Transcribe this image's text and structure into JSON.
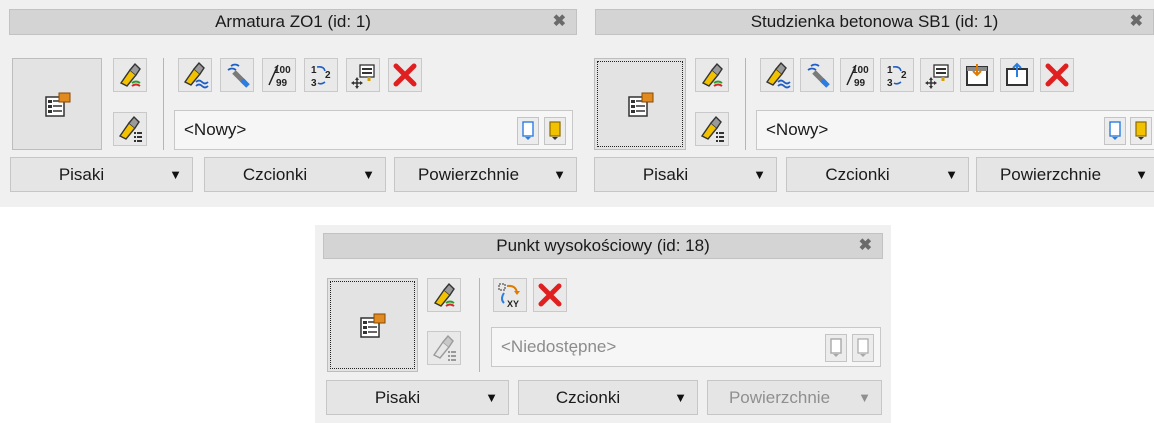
{
  "panels": [
    {
      "title": "Armatura ZO1 (id: 1)",
      "close_glyph": "✖",
      "name_value": "<Nowy>",
      "dropdowns": [
        "Pisaki",
        "Czcionki",
        "Powierzchnie"
      ],
      "toolbar_icons": [
        "brush-wave-icon",
        "brush-line-icon",
        "number-format-icon",
        "renumber-icon",
        "move-text-icon",
        "delete-icon"
      ]
    },
    {
      "title": "Studzienka betonowa SB1 (id: 1)",
      "close_glyph": "✖",
      "name_value": "<Nowy>",
      "dropdowns": [
        "Pisaki",
        "Czcionki",
        "Powierzchnie"
      ],
      "toolbar_icons": [
        "brush-wave-icon",
        "brush-line-icon",
        "number-format-icon",
        "renumber-icon",
        "move-text-icon",
        "frame-in-icon",
        "frame-out-icon",
        "delete-icon"
      ]
    },
    {
      "title": "Punkt wysokościowy (id: 18)",
      "close_glyph": "✖",
      "name_value": "<Niedostępne>",
      "dropdowns": [
        "Pisaki",
        "Czcionki",
        "Powierzchnie"
      ],
      "toolbar_icons": [
        "xy-transform-icon",
        "delete-icon"
      ],
      "disabled_controls": [
        "name-field",
        "style-buttons",
        "powierzchnie-dropdown",
        "brush-list-button"
      ]
    }
  ],
  "arrow_glyph": "▼",
  "colors": {
    "panel_bg": "#f0f0f0",
    "titlebar_bg": "#d4d4d4",
    "delete_red": "#e02020",
    "brush_yellow": "#f2c200"
  }
}
